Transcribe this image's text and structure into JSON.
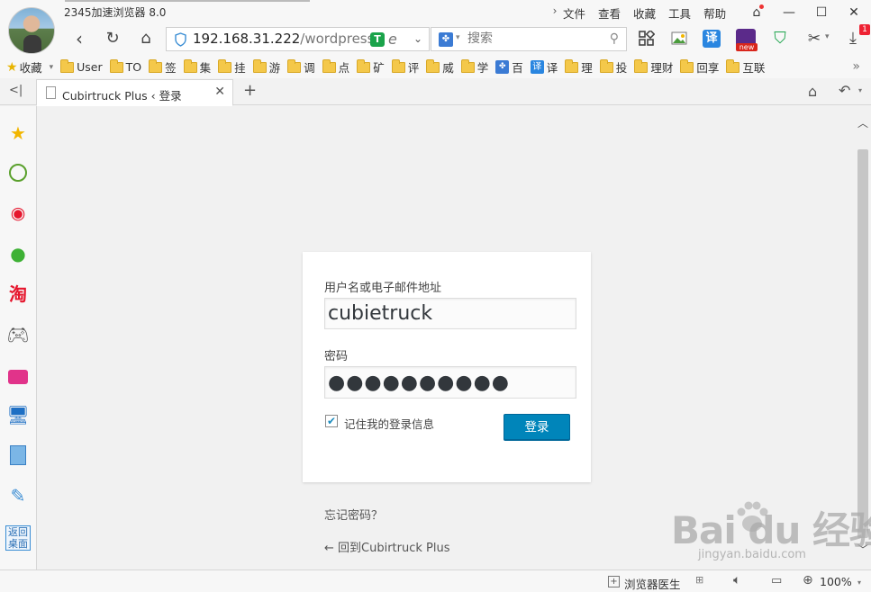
{
  "window": {
    "app_title": "2345加速浏览器 8.0",
    "menu": [
      "文件",
      "查看",
      "收藏",
      "工具",
      "帮助"
    ]
  },
  "nav": {
    "url_host": "192.168.31.222",
    "url_path": "/wordpress",
    "search_placeholder": "搜索"
  },
  "bookmarks": {
    "favorites_label": "收藏",
    "items": [
      {
        "label": "User",
        "icon": "folder"
      },
      {
        "label": "TO",
        "icon": "folder"
      },
      {
        "label": "签",
        "icon": "folder"
      },
      {
        "label": "集",
        "icon": "folder"
      },
      {
        "label": "挂",
        "icon": "folder"
      },
      {
        "label": "游",
        "icon": "folder"
      },
      {
        "label": "调",
        "icon": "folder"
      },
      {
        "label": "点",
        "icon": "folder"
      },
      {
        "label": "矿",
        "icon": "folder"
      },
      {
        "label": "评",
        "icon": "folder"
      },
      {
        "label": "威",
        "icon": "folder"
      },
      {
        "label": "学",
        "icon": "folder"
      },
      {
        "label": "百",
        "icon": "baidu-paw"
      },
      {
        "label": "译",
        "icon": "translate"
      },
      {
        "label": "理",
        "icon": "folder"
      },
      {
        "label": "投",
        "icon": "folder"
      },
      {
        "label": "理财",
        "icon": "folder"
      },
      {
        "label": "回享",
        "icon": "folder"
      },
      {
        "label": "互联",
        "icon": "folder"
      }
    ]
  },
  "tab": {
    "title": "Cubirtruck Plus ‹ 登录"
  },
  "toolbar_icons": {
    "translate_glyph": "译",
    "new_badge": "new",
    "download_badge": "1"
  },
  "sidebar": {
    "taobao_glyph": "淘",
    "desktop_label": "返回\n桌面"
  },
  "login": {
    "username_label": "用户名或电子邮件地址",
    "username_value": "cubietruck",
    "password_label": "密码",
    "password_value": "●●●●●●●●●●",
    "remember_label": "记住我的登录信息",
    "remember_checked": true,
    "submit_label": "登录",
    "lost_password": "忘记密码？",
    "back_link": "← 回到Cubirtruck Plus",
    "button_color": "#0085ba"
  },
  "statusbar": {
    "doctor_label": "浏览器医生",
    "zoom": "100%"
  },
  "watermark": {
    "logo_text": "Bai du 经验",
    "url": "jingyan.baidu.com"
  }
}
